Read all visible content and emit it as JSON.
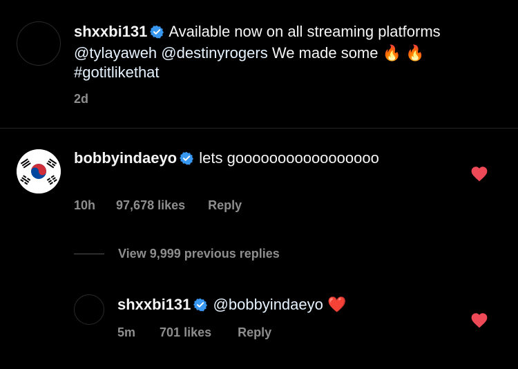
{
  "caption": {
    "username": "shxxbi131",
    "text_before": "Available now on all streaming platforms",
    "mention_1": "@tylayaweh",
    "mention_2": "@destinyrogers",
    "text_mid": "We made some",
    "emoji": "🔥 🔥",
    "hashtag": "#gotitlikethat",
    "time": "2d"
  },
  "comment": {
    "username": "bobbyindaeyo",
    "text": "lets gooooooooooooooooo",
    "time": "10h",
    "likes": "97,678 likes",
    "reply_label": "Reply"
  },
  "view_replies": "View 9,999 previous replies",
  "reply": {
    "username": "shxxbi131",
    "mention": "@bobbyindaeyo",
    "emoji": "❤️",
    "time": "5m",
    "likes": "701 likes",
    "reply_label": "Reply"
  },
  "colors": {
    "background": "#000000",
    "verified": "#3897f0",
    "heart": "#ed4956",
    "meta": "#8e8e8e"
  }
}
